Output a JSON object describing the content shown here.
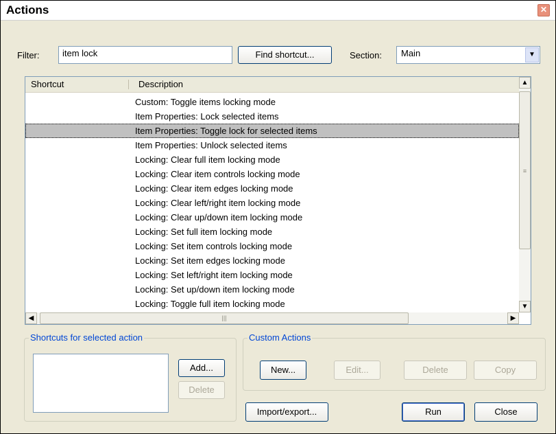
{
  "window": {
    "title": "Actions"
  },
  "filter": {
    "label": "Filter:",
    "value": "item lock"
  },
  "find_shortcut_label": "Find shortcut...",
  "section": {
    "label": "Section:",
    "value": "Main"
  },
  "list": {
    "columns": [
      "Shortcut",
      "Description"
    ],
    "selected_index": 2,
    "rows": [
      "Custom: Toggle items locking mode",
      "Item Properties: Lock selected items",
      "Item Properties: Toggle lock for selected items",
      "Item Properties: Unlock selected items",
      "Locking: Clear full item locking mode",
      "Locking: Clear item controls locking mode",
      "Locking: Clear item edges locking mode",
      "Locking: Clear left/right item locking mode",
      "Locking: Clear up/down item locking mode",
      "Locking: Set full item locking mode",
      "Locking: Set item controls locking mode",
      "Locking: Set item edges locking mode",
      "Locking: Set left/right item locking mode",
      "Locking: Set up/down item locking mode",
      "Locking: Toggle full item locking mode"
    ]
  },
  "shortcuts_group": {
    "title": "Shortcuts for selected action",
    "add_label": "Add...",
    "delete_label": "Delete"
  },
  "custom_group": {
    "title": "Custom Actions",
    "new_label": "New...",
    "edit_label": "Edit...",
    "delete_label": "Delete",
    "copy_label": "Copy"
  },
  "import_export_label": "Import/export...",
  "run_label": "Run",
  "close_label": "Close",
  "icons": {
    "close": "close-icon",
    "dropdown": "chevron-down-icon",
    "scroll_up": "arrow-up-icon",
    "scroll_down": "arrow-down-icon",
    "scroll_left": "arrow-left-icon",
    "scroll_right": "arrow-right-icon"
  }
}
